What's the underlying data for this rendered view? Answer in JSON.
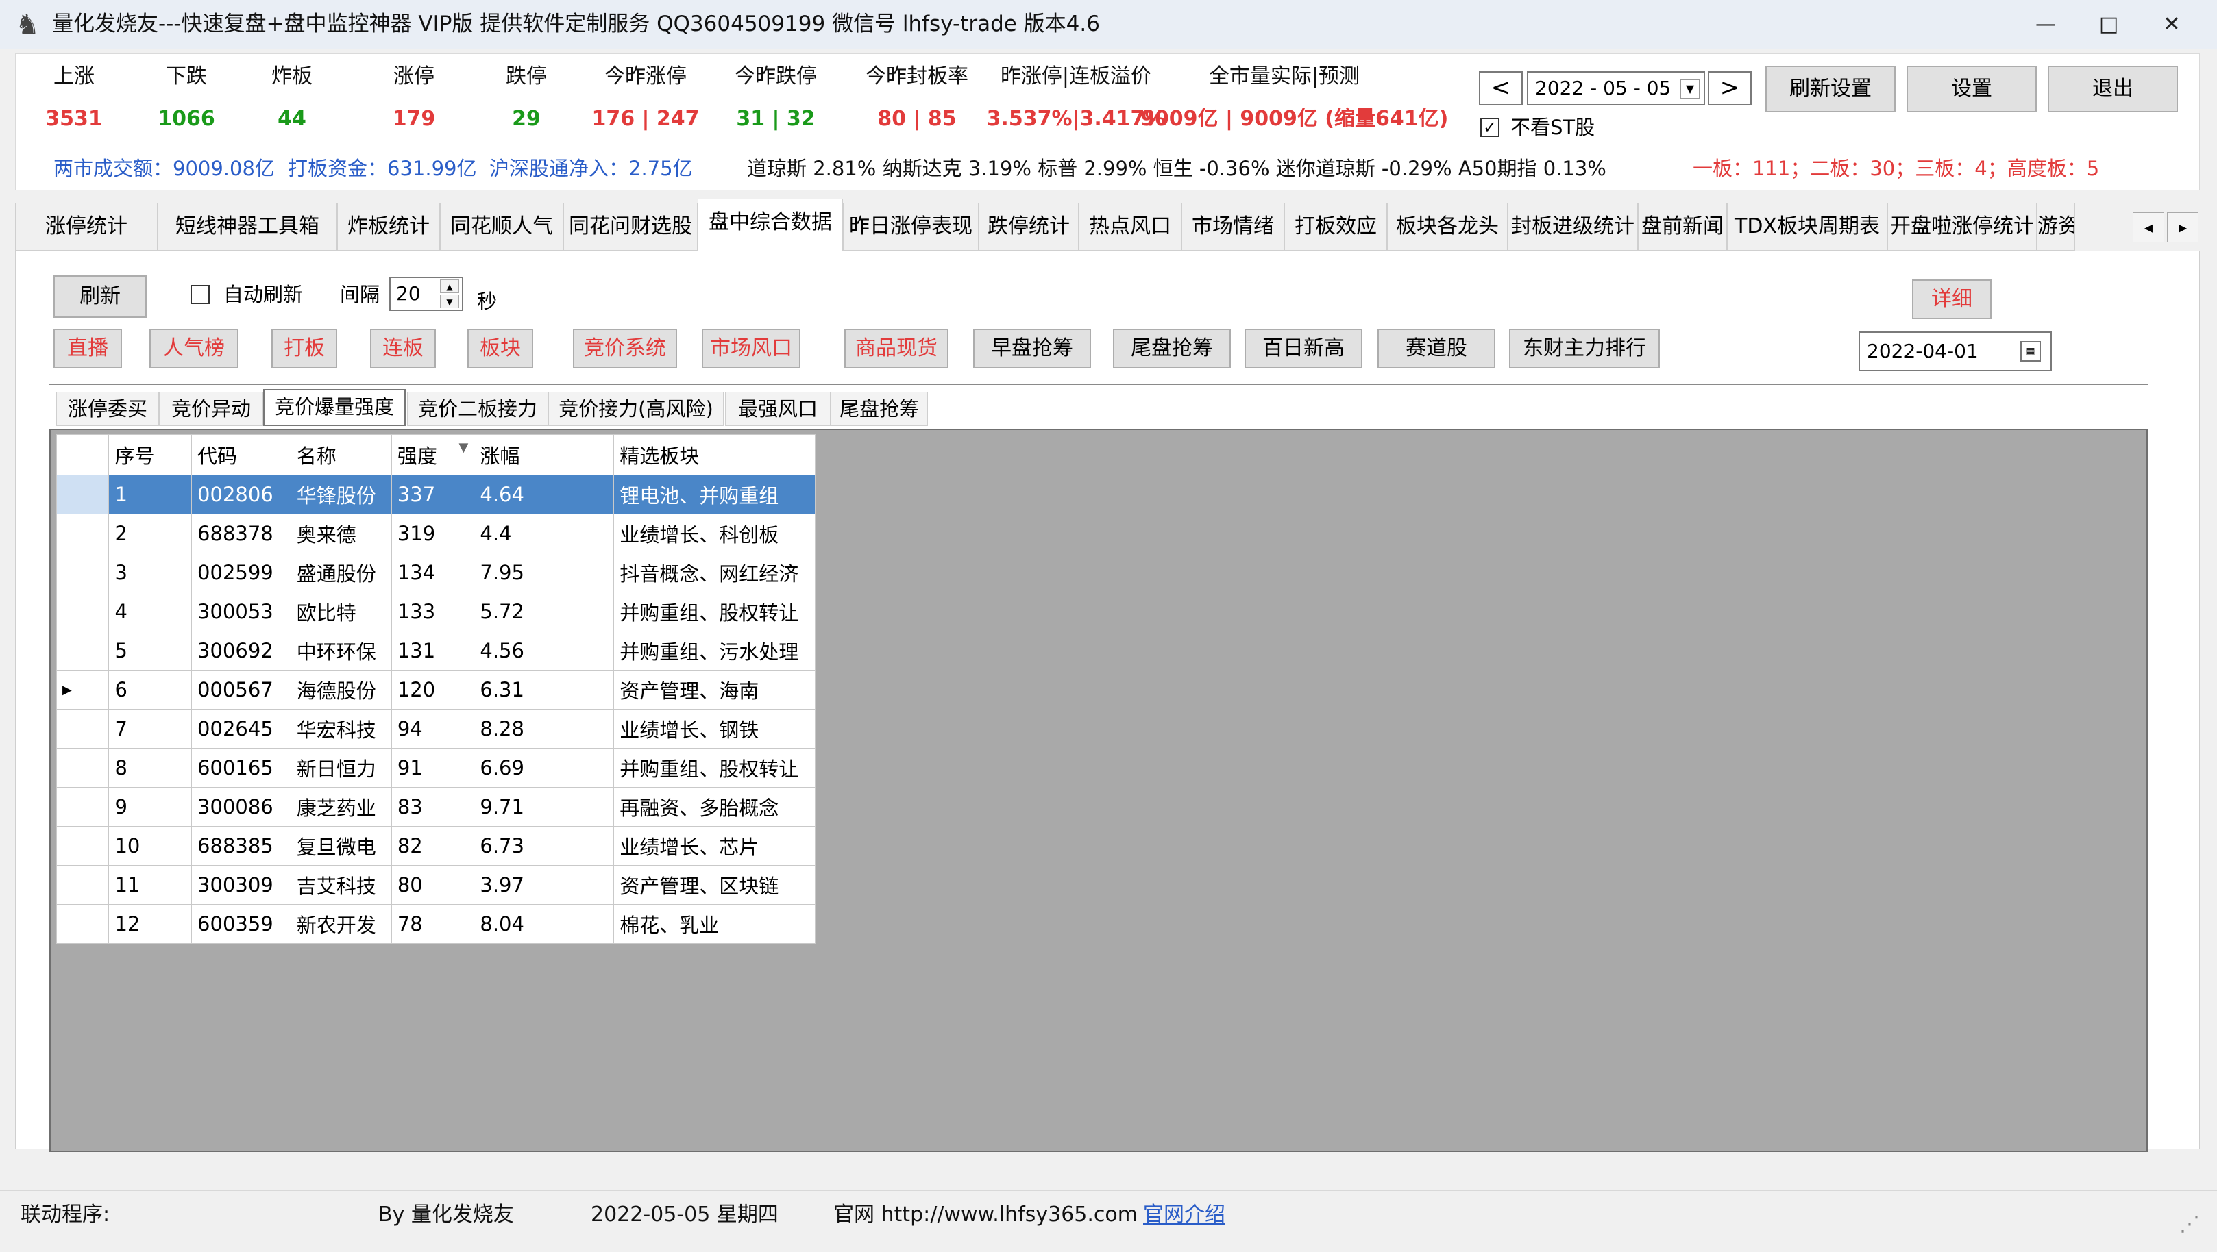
{
  "window": {
    "title": "量化发烧友---快速复盘+盘中监控神器 VIP版  提供软件定制服务 QQ3604509199 微信号 lhfsy-trade   版本4.6",
    "minimize": "—",
    "maximize": "□",
    "close": "✕"
  },
  "colors": {
    "red": "#e23b3b",
    "green": "#1a9a1a",
    "blue": "#2a5dc8",
    "selected_row": "#4a86c8"
  },
  "stats": [
    {
      "label": "上涨",
      "value": "3531",
      "color": "#e23b3b"
    },
    {
      "label": "下跌",
      "value": "1066",
      "color": "#1a9a1a"
    },
    {
      "label": "炸板",
      "value": "44",
      "color": "#1a9a1a"
    },
    {
      "label": "涨停",
      "value": "179",
      "color": "#e23b3b"
    },
    {
      "label": "跌停",
      "value": "29",
      "color": "#1a9a1a"
    },
    {
      "label": "今昨涨停",
      "value": "176 | 247",
      "color": "#e23b3b"
    },
    {
      "label": "今昨跌停",
      "value": "31 | 32",
      "color": "#1a9a1a"
    },
    {
      "label": "今昨封板率",
      "value": "80 | 85",
      "color": "#e23b3b"
    },
    {
      "label": "昨涨停|连板溢价",
      "value": "3.537%|3.417%",
      "color": "#e23b3b"
    },
    {
      "label": "全市量实际|预测",
      "value": "9009亿 | 9009亿 (缩量641亿)",
      "color": "#e23b3b"
    }
  ],
  "row2": {
    "turnover": "两市成交额：9009.08亿",
    "limit_funds": "打板资金：631.99亿",
    "northbound": "沪深股通净入：2.75亿",
    "indices": "道琼斯 2.81%  纳斯达克 3.19%  标普 2.99%  恒生 -0.36%  迷你道琼斯 -0.29%  A50期指 0.13%",
    "boards": "一板：111；二板：30；三板：4；高度板：5"
  },
  "controls": {
    "date": "2022 - 05 - 05",
    "prev": "<",
    "next": ">",
    "refresh_settings": "刷新设置",
    "settings": "设置",
    "exit": "退出",
    "hide_st": "不看ST股",
    "check_mark": "✓"
  },
  "tabs": [
    "涨停统计",
    "短线神器工具箱",
    "炸板统计",
    "同花顺人气",
    "同花问财选股",
    "盘中综合数据",
    "昨日涨停表现",
    "跌停统计",
    "热点风口",
    "市场情绪",
    "打板效应",
    "板块各龙头",
    "封板进级统计",
    "盘前新闻",
    "TDX板块周期表",
    "开盘啦涨停统计",
    "游资"
  ],
  "tab_arrows": {
    "left": "◂",
    "right": "▸"
  },
  "toolbar": {
    "refresh": "刷新",
    "auto_refresh": "自动刷新",
    "interval_label": "间隔",
    "interval_value": "20",
    "seconds": "秒",
    "detail": "详细",
    "spin_up": "▲",
    "spin_down": "▼",
    "side_date": "2022-04-01"
  },
  "red_buttons": [
    "直播",
    "人气榜",
    "打板",
    "连板",
    "板块",
    "竞价系统",
    "市场风口",
    "商品现货"
  ],
  "black_buttons": [
    "早盘抢筹",
    "尾盘抢筹",
    "百日新高",
    "赛道股",
    "东财主力排行"
  ],
  "subtabs": [
    "涨停委买",
    "竞价异动",
    "竞价爆量强度",
    "竞价二板接力",
    "竞价接力(高风险)",
    "最强风口",
    "尾盘抢筹"
  ],
  "table": {
    "headers": [
      "序号",
      "代码",
      "名称",
      "强度",
      "涨幅",
      "精选板块"
    ],
    "sort_icon": "▼",
    "row_pointer": "▶",
    "rows": [
      [
        "1",
        "002806",
        "华锋股份",
        "337",
        "4.64",
        "锂电池、并购重组"
      ],
      [
        "2",
        "688378",
        "奥来德",
        "319",
        "4.4",
        "业绩增长、科创板"
      ],
      [
        "3",
        "002599",
        "盛通股份",
        "134",
        "7.95",
        "抖音概念、网红经济"
      ],
      [
        "4",
        "300053",
        "欧比特",
        "133",
        "5.72",
        "并购重组、股权转让"
      ],
      [
        "5",
        "300692",
        "中环环保",
        "131",
        "4.56",
        "并购重组、污水处理"
      ],
      [
        "6",
        "000567",
        "海德股份",
        "120",
        "6.31",
        "资产管理、海南"
      ],
      [
        "7",
        "002645",
        "华宏科技",
        "94",
        "8.28",
        "业绩增长、钢铁"
      ],
      [
        "8",
        "600165",
        "新日恒力",
        "91",
        "6.69",
        "并购重组、股权转让"
      ],
      [
        "9",
        "300086",
        "康芝药业",
        "83",
        "9.71",
        "再融资、多胎概念"
      ],
      [
        "10",
        "688385",
        "复旦微电",
        "82",
        "6.73",
        "业绩增长、芯片"
      ],
      [
        "11",
        "300309",
        "吉艾科技",
        "80",
        "3.97",
        "资产管理、区块链"
      ],
      [
        "12",
        "600359",
        "新农开发",
        "78",
        "8.04",
        "棉花、乳业"
      ]
    ]
  },
  "statusbar": {
    "linked": "联动程序:",
    "by": "By 量化发烧友",
    "date": "2022-05-05 星期四",
    "site": "官网 http://www.lhfsy365.com",
    "intro": "官网介绍",
    "grip": "⋰"
  },
  "icons": {
    "app": "app-logo-icon",
    "calendar": "calendar-icon"
  }
}
